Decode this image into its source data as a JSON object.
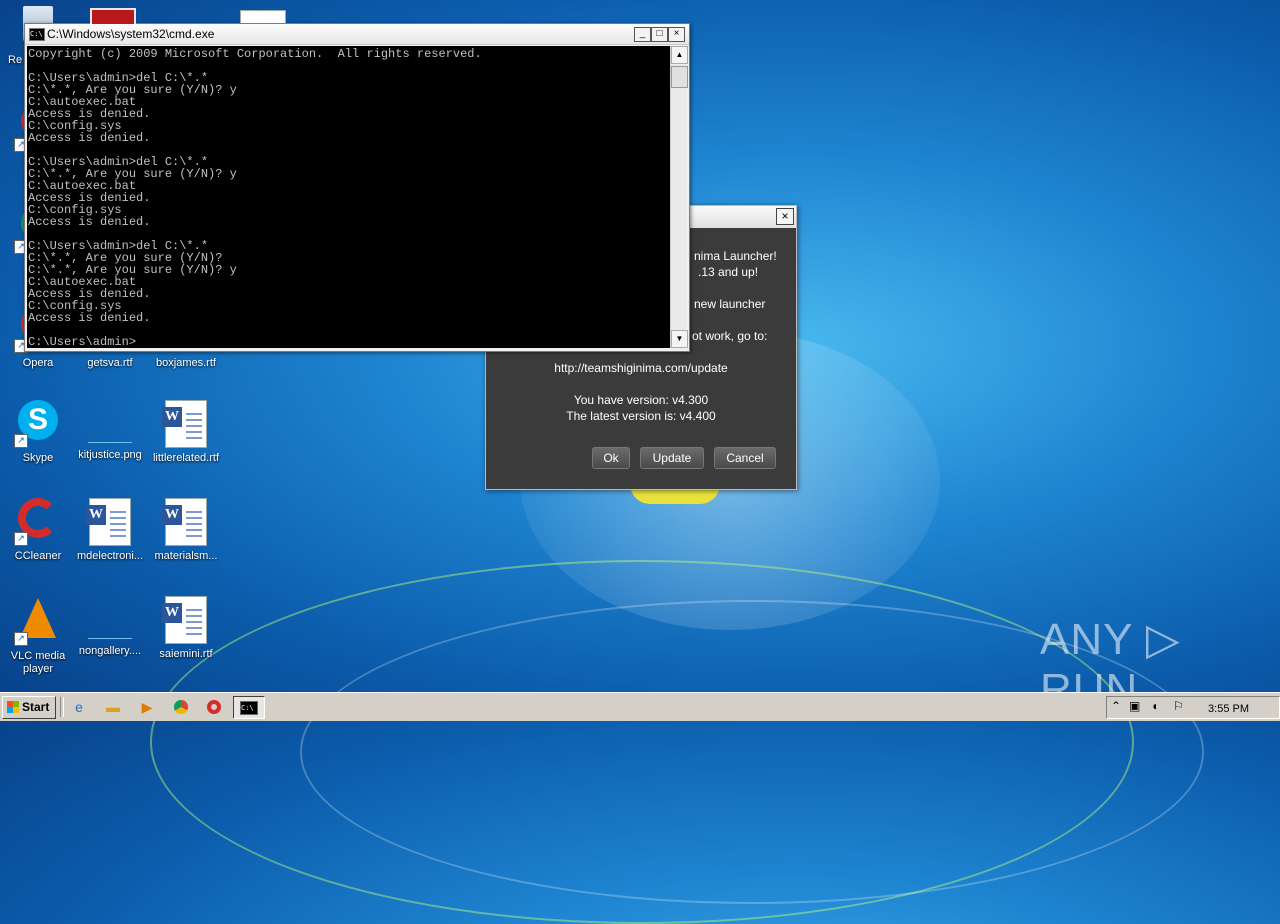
{
  "desktop": {
    "icons": [
      {
        "label": "Re",
        "name": "recycle-bin"
      },
      {
        "label": "Opera",
        "name": "opera"
      },
      {
        "label": "getsva.rtf",
        "name": "getsva-rtf"
      },
      {
        "label": "boxjames.rtf",
        "name": "boxjames-rtf"
      },
      {
        "label": "Skype",
        "name": "skype"
      },
      {
        "label": "kitjustice.png",
        "name": "kitjustice-png"
      },
      {
        "label": "littlerelated.rtf",
        "name": "littlerelated-rtf"
      },
      {
        "label": "CCleaner",
        "name": "ccleaner"
      },
      {
        "label": "mdelectroni...",
        "name": "mdelectroni"
      },
      {
        "label": "materialsm...",
        "name": "materialsm"
      },
      {
        "label": "VLC media player",
        "name": "vlc"
      },
      {
        "label": "nongallery....",
        "name": "nongallery"
      },
      {
        "label": "saiemini.rtf",
        "name": "saiemini-rtf"
      }
    ]
  },
  "cmd": {
    "title": "C:\\Windows\\system32\\cmd.exe",
    "icon_text": "C:\\",
    "lines": "Copyright (c) 2009 Microsoft Corporation.  All rights reserved.\n\nC:\\Users\\admin>del C:\\*.*\nC:\\*.*, Are you sure (Y/N)? y\nC:\\autoexec.bat\nAccess is denied.\nC:\\config.sys\nAccess is denied.\n\nC:\\Users\\admin>del C:\\*.*\nC:\\*.*, Are you sure (Y/N)? y\nC:\\autoexec.bat\nAccess is denied.\nC:\\config.sys\nAccess is denied.\n\nC:\\Users\\admin>del C:\\*.*\nC:\\*.*, Are you sure (Y/N)?\nC:\\*.*, Are you sure (Y/N)? y\nC:\\autoexec.bat\nAccess is denied.\nC:\\config.sys\nAccess is denied.\n\nC:\\Users\\admin>",
    "min_label": "_",
    "max_label": "□",
    "close_label": "×"
  },
  "launcher": {
    "line1": "nima Launcher!",
    "line2": ".13 and up!",
    "line3": "new launcher",
    "line4": "ot work, go to:",
    "url": "http://teamshiginima.com/update",
    "you_have": "You have version: v4.300",
    "latest": "The latest version is: v4.400",
    "ok_label": "Ok",
    "update_label": "Update",
    "cancel_label": "Cancel",
    "close_label": "×"
  },
  "taskbar": {
    "start_label": "Start",
    "clock": "3:55 PM",
    "cmd_task_label": "C:\\"
  },
  "watermark": "ANY ▷ RUN"
}
